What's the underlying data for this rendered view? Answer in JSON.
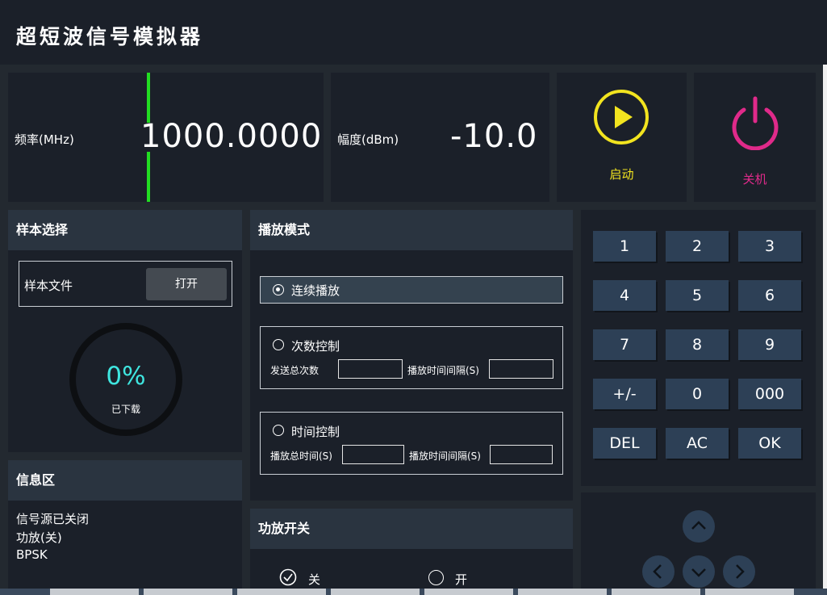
{
  "app": {
    "title": "超短波信号模拟器"
  },
  "frequency": {
    "label": "频率(MHz)",
    "value": "1000.0000"
  },
  "amplitude": {
    "label": "幅度(dBm)",
    "value": "-10.0"
  },
  "start": {
    "label": "启动",
    "color": "#f2e41f"
  },
  "power": {
    "label": "关机",
    "color": "#e02a8a"
  },
  "sample": {
    "header": "样本选择",
    "file_label": "样本文件",
    "open_button": "打开",
    "progress_percent": "0%",
    "progress_value": 0,
    "progress_caption": "已下载"
  },
  "info": {
    "header": "信息区",
    "lines": [
      "信号源已关闭",
      "功放(关)",
      "BPSK"
    ]
  },
  "play_mode": {
    "header": "播放模式",
    "continuous": "连续播放",
    "count_control": "次数控制",
    "total_count_label": "发送总次数",
    "interval_label_1": "播放时间间隔(S)",
    "time_control": "时间控制",
    "total_time_label": "播放总时间(S)",
    "interval_label_2": "播放时间间隔(S)",
    "selected": "连续播放"
  },
  "amp_switch": {
    "header": "功放开关",
    "off": "关",
    "on": "开",
    "selected": "关"
  },
  "keypad": {
    "keys": [
      "1",
      "2",
      "3",
      "4",
      "5",
      "6",
      "7",
      "8",
      "9",
      "+/-",
      "0",
      "000",
      "DEL",
      "AC",
      "OK"
    ]
  },
  "nav": {
    "icons": [
      "up-arrow-icon",
      "left-arrow-icon",
      "down-arrow-icon",
      "right-arrow-icon"
    ]
  }
}
